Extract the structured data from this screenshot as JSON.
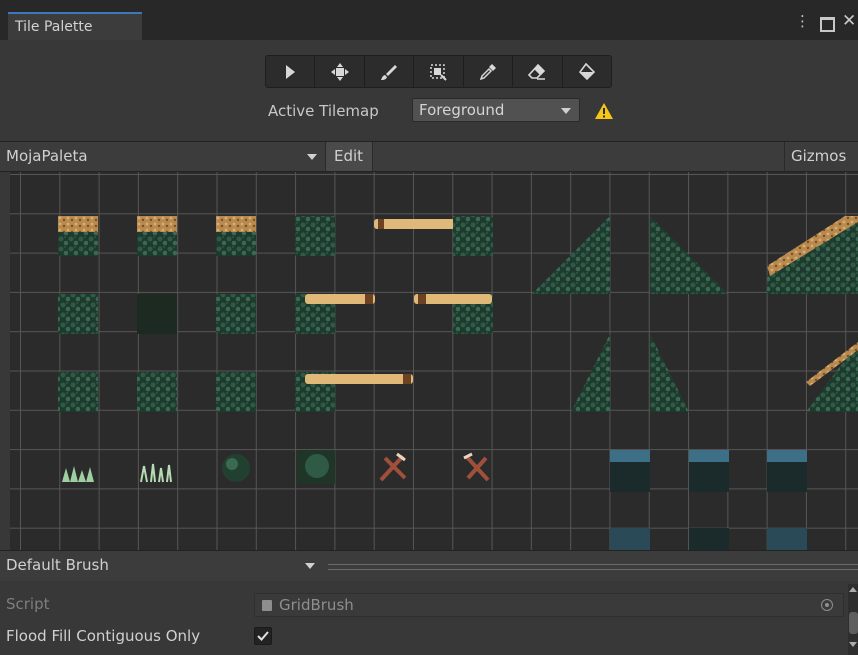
{
  "window": {
    "tab_title": "Tile Palette",
    "menu_icon": "kebab-menu-icon",
    "maximize_icon": "maximize-icon",
    "close_icon": "close-icon"
  },
  "toolbar": {
    "tools": [
      {
        "name": "select-tool",
        "icon": "arrow-cursor-icon"
      },
      {
        "name": "move-tool",
        "icon": "move-arrows-icon"
      },
      {
        "name": "paint-tool",
        "icon": "brush-icon"
      },
      {
        "name": "box-fill-tool",
        "icon": "box-fill-icon"
      },
      {
        "name": "pick-tool",
        "icon": "eyedropper-icon"
      },
      {
        "name": "erase-tool",
        "icon": "eraser-icon"
      },
      {
        "name": "fill-tool",
        "icon": "paint-bucket-icon"
      }
    ]
  },
  "active_tilemap": {
    "label": "Active Tilemap",
    "value": "Foreground",
    "warning_icon": "warning-icon"
  },
  "palette_bar": {
    "palette_name": "MojaPaleta",
    "edit_label": "Edit",
    "gizmos_label": "Gizmos"
  },
  "brush": {
    "selected": "Default Brush"
  },
  "inspector": {
    "script_label": "Script",
    "script_value": "GridBrush",
    "flood_fill_label": "Flood Fill Contiguous Only",
    "flood_fill_checked": true
  },
  "colors": {
    "accent": "#3a79bb",
    "warning": "#f5c518",
    "dirt": "#c49a5c",
    "leaf_dark": "#1e3a2e",
    "leaf_mid": "#2f5a45",
    "log": "#e0b878",
    "water_blue": "#3d6f86"
  }
}
